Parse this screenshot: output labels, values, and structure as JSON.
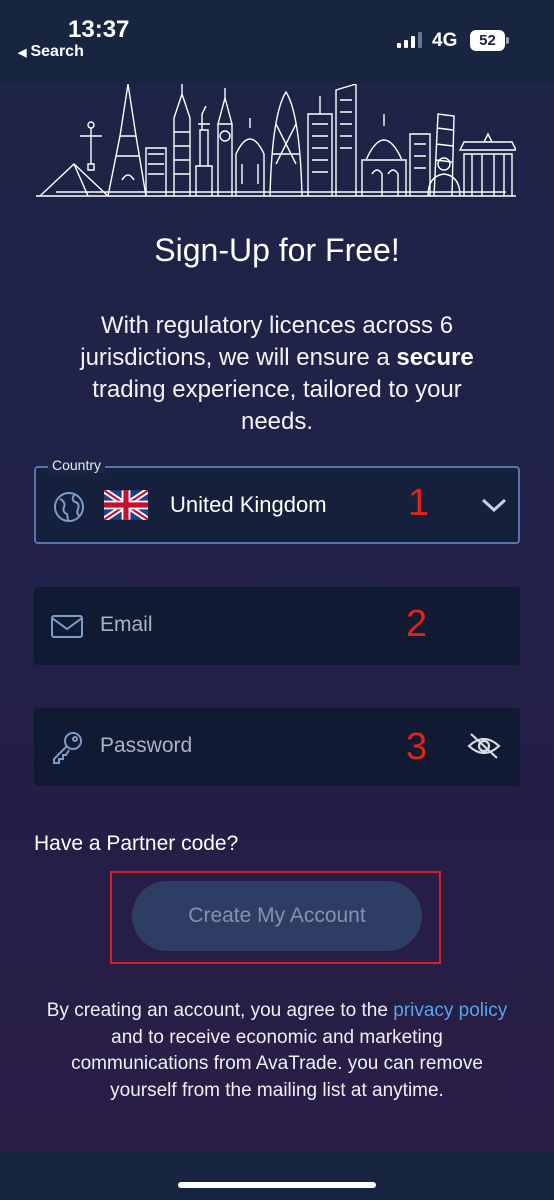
{
  "status_bar": {
    "time": "13:37",
    "back_label": "Search",
    "network": "4G",
    "battery": "52"
  },
  "page": {
    "title": "Sign-Up for Free!",
    "intro_before": "With regulatory licences across 6 jurisdictions, we will ensure a ",
    "intro_bold": "secure",
    "intro_after": " trading experience, tailored to your needs."
  },
  "form": {
    "country": {
      "legend": "Country",
      "value": "United Kingdom",
      "icon": "globe-icon",
      "flag": "uk-flag",
      "marker": "1"
    },
    "email": {
      "placeholder": "Email",
      "icon": "mail-icon",
      "marker": "2"
    },
    "password": {
      "placeholder": "Password",
      "icon": "key-icon",
      "toggle_icon": "eye-off-icon",
      "marker": "3"
    },
    "partner_link": "Have a Partner code?",
    "submit_label": "Create My Account"
  },
  "legal": {
    "before": "By creating an account, you agree to the ",
    "link": "privacy policy",
    "after": "and to receive economic and marketing communications from AvaTrade. you can remove yourself from the mailing list at anytime."
  },
  "colors": {
    "background": "#1d2546",
    "field_bg": "#101a33",
    "accent_link": "#5aa3ea",
    "annotation_red": "#e2231a",
    "button_bg": "#2e3d63"
  }
}
